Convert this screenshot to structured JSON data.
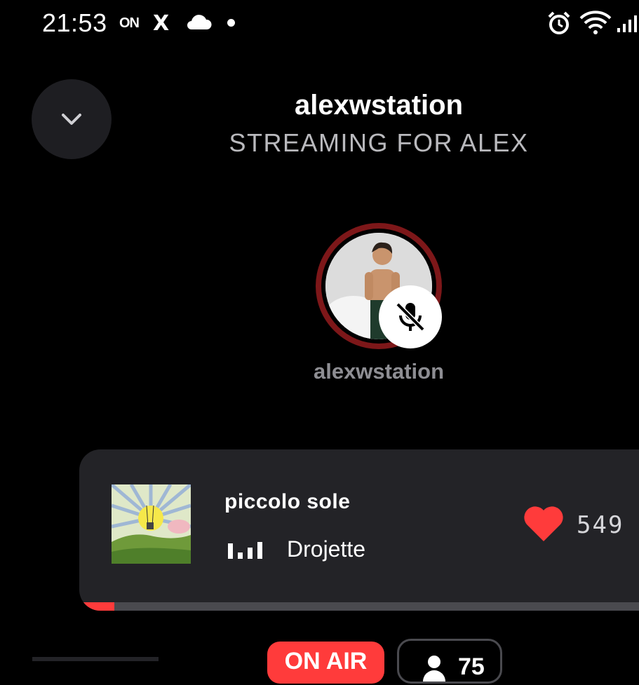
{
  "status_bar": {
    "time": "21:53",
    "on_badge": "ON",
    "x_logo": "X",
    "icons": [
      "on-app-icon",
      "x-logo-icon",
      "cloud-icon",
      "notification-dot-icon",
      "alarm-icon",
      "wifi-icon",
      "cellular-signal-icon"
    ]
  },
  "header": {
    "collapse_icon": "chevron-down-icon",
    "station_name": "alexwstation",
    "subtitle": "STREAMING FOR ALEX"
  },
  "host": {
    "name": "alexwstation",
    "mic_status_icon": "mic-muted-icon"
  },
  "now_playing": {
    "title": "piccolo sole",
    "artist": "Drojette",
    "playing_icon": "equalizer-icon",
    "like_icon": "heart-icon",
    "likes": "549",
    "progress": 0.06
  },
  "bottom": {
    "on_air_label": "ON AIR",
    "listener_count": "75"
  },
  "colors": {
    "background": "#000000",
    "card": "#232327",
    "accent_red": "#ff3b3b",
    "ring": "#7d1719",
    "muted_text": "#8e8e93"
  }
}
